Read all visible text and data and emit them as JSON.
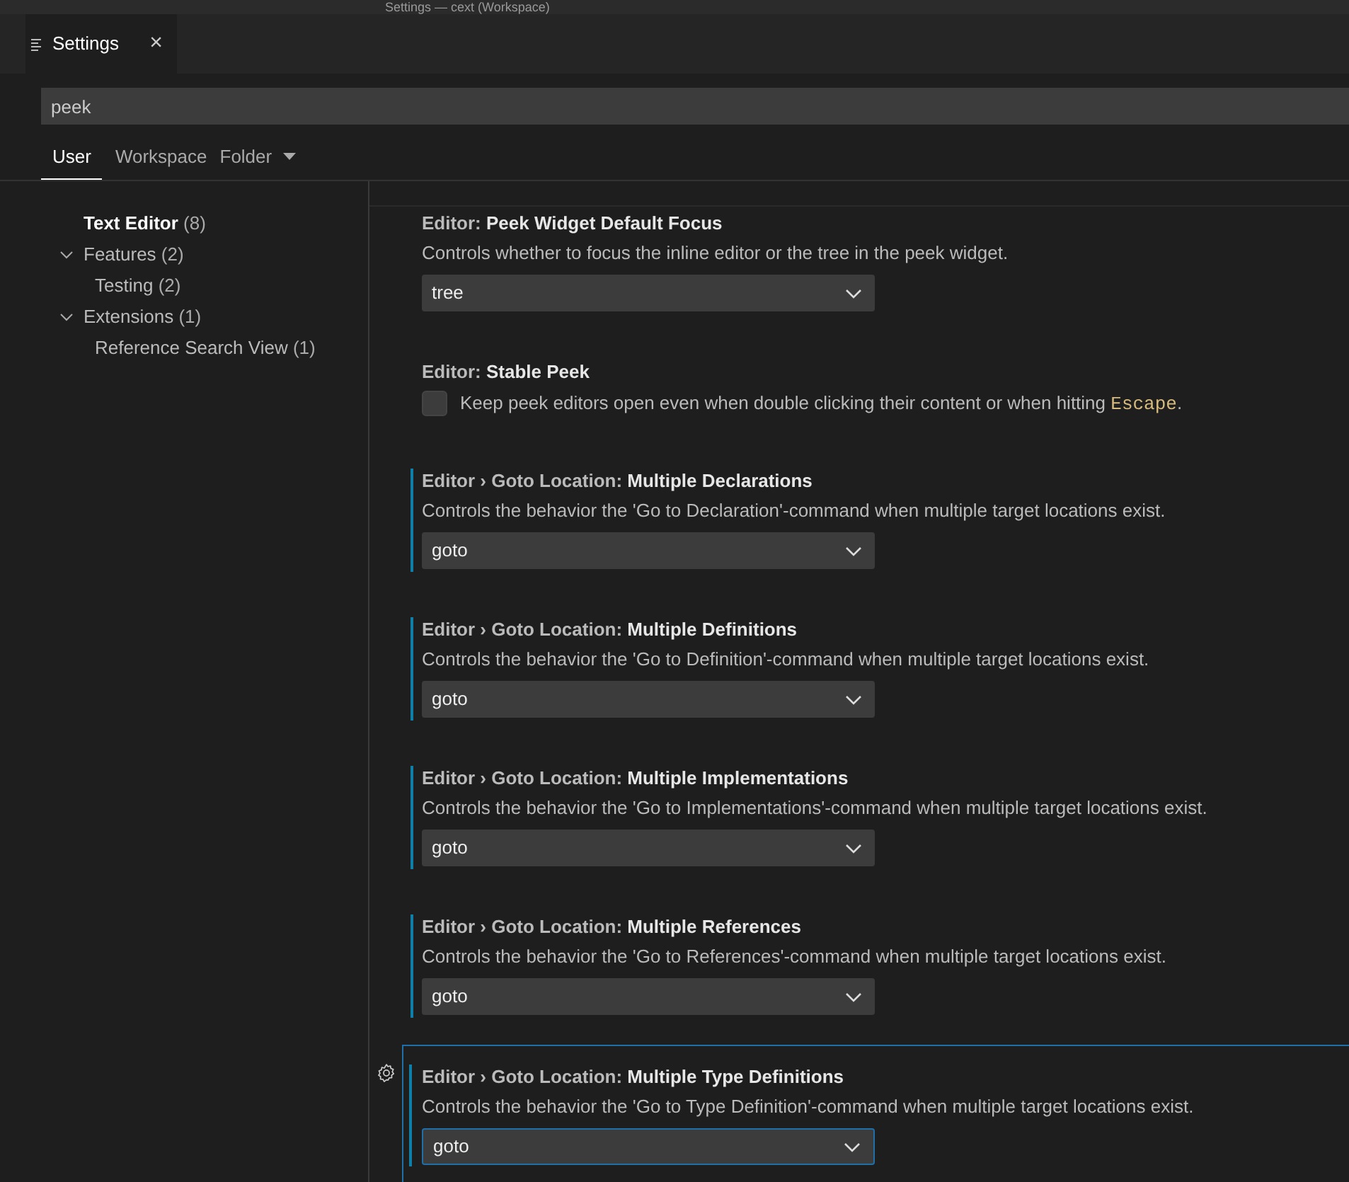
{
  "window": {
    "title": "Settings — cext (Workspace)"
  },
  "editor_tab": {
    "label": "Settings",
    "close": "×"
  },
  "search": {
    "value": "peek"
  },
  "scope_tabs": [
    {
      "label": "User",
      "selected": true,
      "dropdown": false
    },
    {
      "label": "Workspace",
      "selected": false,
      "dropdown": false
    },
    {
      "label": "Folder",
      "selected": false,
      "dropdown": true
    }
  ],
  "toc": [
    {
      "label": "Text Editor",
      "count": "(8)",
      "bold": true,
      "children": [
        {
          "label": "Features",
          "count": "(2)",
          "expanded": true,
          "children": [
            {
              "label": "Testing",
              "count": "(2)"
            }
          ]
        },
        {
          "label": "Extensions",
          "count": "(1)",
          "expanded": true,
          "children": [
            {
              "label": "Reference Search View",
              "count": "(1)"
            }
          ]
        }
      ]
    }
  ],
  "settings": [
    {
      "kind": "dropdown",
      "category": "Editor: ",
      "title": "Peek Widget Default Focus",
      "description": "Controls whether to focus the inline editor or the tree in the peek widget.",
      "value": "tree",
      "modified": false,
      "focused": false
    },
    {
      "kind": "checkbox",
      "category": "Editor: ",
      "title": "Stable Peek",
      "description": "Keep peek editors open even when double clicking their content or when hitting ",
      "code": "Escape",
      "suffix": ".",
      "checked": false,
      "modified": false,
      "focused": false
    },
    {
      "kind": "dropdown",
      "category": "Editor › Goto Location: ",
      "title": "Multiple Declarations",
      "description": "Controls the behavior the 'Go to Declaration'-command when multiple target locations exist.",
      "value": "goto",
      "modified": true,
      "focused": false
    },
    {
      "kind": "dropdown",
      "category": "Editor › Goto Location: ",
      "title": "Multiple Definitions",
      "description": "Controls the behavior the 'Go to Definition'-command when multiple target locations exist.",
      "value": "goto",
      "modified": true,
      "focused": false
    },
    {
      "kind": "dropdown",
      "category": "Editor › Goto Location: ",
      "title": "Multiple Implementations",
      "description": "Controls the behavior the 'Go to Implementations'-command when multiple target locations exist.",
      "value": "goto",
      "modified": true,
      "focused": false
    },
    {
      "kind": "dropdown",
      "category": "Editor › Goto Location: ",
      "title": "Multiple References",
      "description": "Controls the behavior the 'Go to References'-command when multiple target locations exist.",
      "value": "goto",
      "modified": true,
      "focused": false
    },
    {
      "kind": "dropdown",
      "category": "Editor › Goto Location: ",
      "title": "Multiple Type Definitions",
      "description": "Controls the behavior the 'Go to Type Definition'-command when multiple target locations exist.",
      "value": "goto",
      "modified": true,
      "focused": true
    }
  ]
}
